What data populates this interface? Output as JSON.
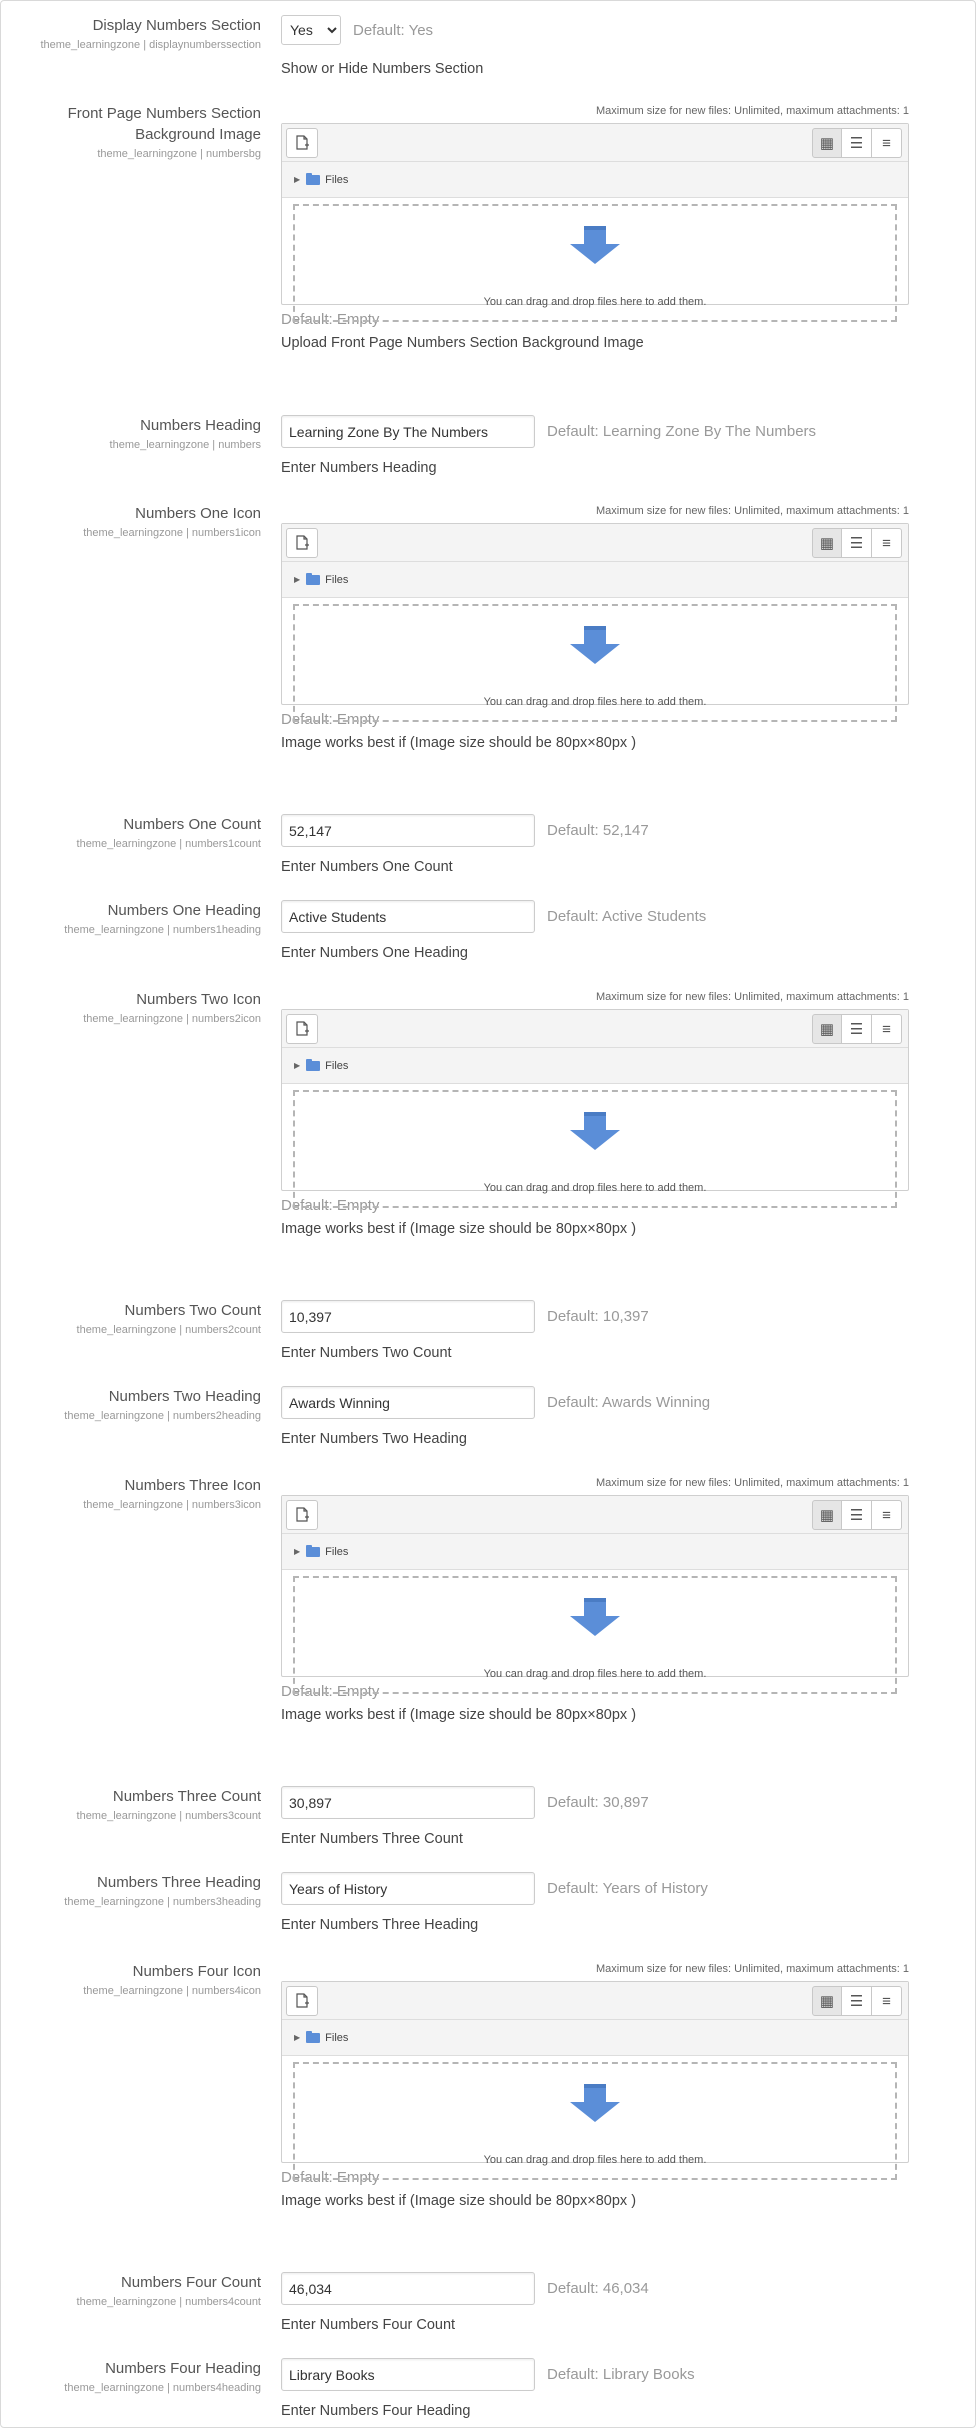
{
  "display_numbers": {
    "title": "Display Numbers Section",
    "sub": "theme_learningzone | displaynumberssection",
    "value": "Yes",
    "default": "Default: Yes",
    "desc": "Show or Hide Numbers Section"
  },
  "filepicker": {
    "maxsize": "Maximum size for new files: Unlimited, maximum attachments: 1",
    "files_label": "Files",
    "drop_msg": "You can drag and drop files here to add them.",
    "accent": "#5b8ed8"
  },
  "bg_image": {
    "title": "Front Page Numbers Section Background Image",
    "sub": "theme_learningzone | numbersbg",
    "default": "Default: Empty",
    "desc": "Upload Front Page Numbers Section Background Image"
  },
  "numbers_heading": {
    "title": "Numbers Heading",
    "sub": "theme_learningzone | numbers",
    "value": "Learning Zone By The Numbers",
    "default": "Default: Learning Zone By The Numbers",
    "desc": "Enter Numbers Heading"
  },
  "one_icon": {
    "title": "Numbers One Icon",
    "sub": "theme_learningzone | numbers1icon",
    "default": "Default: Empty",
    "desc": "Image works best if (Image size should be 80px×80px )"
  },
  "one_count": {
    "title": "Numbers One Count",
    "sub": "theme_learningzone | numbers1count",
    "value": "52,147",
    "default": "Default: 52,147",
    "desc": "Enter Numbers One Count"
  },
  "one_heading": {
    "title": "Numbers One Heading",
    "sub": "theme_learningzone | numbers1heading",
    "value": "Active Students",
    "default": "Default: Active Students",
    "desc": "Enter Numbers One Heading"
  },
  "two_icon": {
    "title": "Numbers Two Icon",
    "sub": "theme_learningzone | numbers2icon",
    "default": "Default: Empty",
    "desc": "Image works best if (Image size should be 80px×80px )"
  },
  "two_count": {
    "title": "Numbers Two Count",
    "sub": "theme_learningzone | numbers2count",
    "value": "10,397",
    "default": "Default: 10,397",
    "desc": "Enter Numbers Two Count"
  },
  "two_heading": {
    "title": "Numbers Two Heading",
    "sub": "theme_learningzone | numbers2heading",
    "value": "Awards Winning",
    "default": "Default: Awards Winning",
    "desc": "Enter Numbers Two Heading"
  },
  "three_icon": {
    "title": "Numbers Three Icon",
    "sub": "theme_learningzone | numbers3icon",
    "default": "Default: Empty",
    "desc": "Image works best if (Image size should be 80px×80px )"
  },
  "three_count": {
    "title": "Numbers Three Count",
    "sub": "theme_learningzone | numbers3count",
    "value": "30,897",
    "default": "Default: 30,897",
    "desc": "Enter Numbers Three Count"
  },
  "three_heading": {
    "title": "Numbers Three Heading",
    "sub": "theme_learningzone | numbers3heading",
    "value": "Years of History",
    "default": "Default: Years of History",
    "desc": "Enter Numbers Three Heading"
  },
  "four_icon": {
    "title": "Numbers Four Icon",
    "sub": "theme_learningzone | numbers4icon",
    "default": "Default: Empty",
    "desc": "Image works best if (Image size should be 80px×80px )"
  },
  "four_count": {
    "title": "Numbers Four Count",
    "sub": "theme_learningzone | numbers4count",
    "value": "46,034",
    "default": "Default: 46,034",
    "desc": "Enter Numbers Four Count"
  },
  "four_heading": {
    "title": "Numbers Four Heading",
    "sub": "theme_learningzone | numbers4heading",
    "value": "Library Books",
    "default": "Default: Library Books",
    "desc": "Enter Numbers Four Heading"
  }
}
